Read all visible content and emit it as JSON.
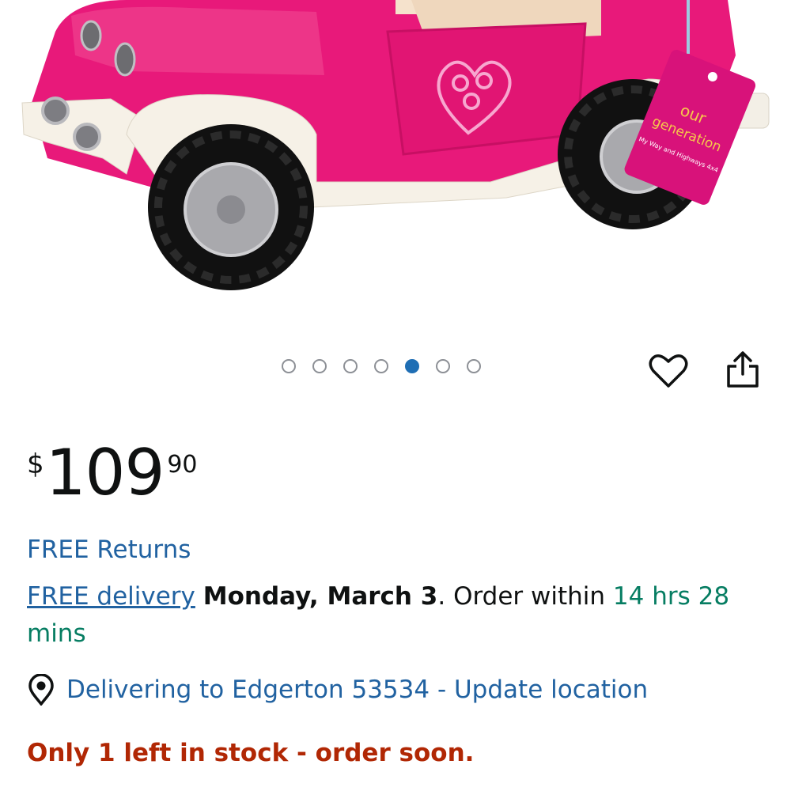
{
  "product_image": {
    "brand_tag_line1": "our",
    "brand_tag_line2": "generation",
    "tag_subtitle": "My Way and Highways 4x4"
  },
  "carousel": {
    "total": 7,
    "active_index": 4
  },
  "actions": {
    "favorite_icon": "heart-icon",
    "share_icon": "share-icon"
  },
  "price": {
    "currency": "$",
    "whole": "109",
    "fraction": "90"
  },
  "returns": {
    "label": "FREE Returns"
  },
  "delivery": {
    "link_label": "FREE delivery",
    "date": "Monday, March 3",
    "after_date": ". Order within ",
    "countdown": "14 hrs 28 mins"
  },
  "location": {
    "icon": "location-pin-icon",
    "label": "Delivering to Edgerton 53534 - Update location"
  },
  "stock": {
    "message": "Only 1 left in stock - order soon."
  },
  "colors": {
    "link": "#2162a1",
    "countdown": "#067d62",
    "stock": "#b12704",
    "active_dot": "#1f6eb4",
    "jeep_pink": "#e8197a"
  }
}
